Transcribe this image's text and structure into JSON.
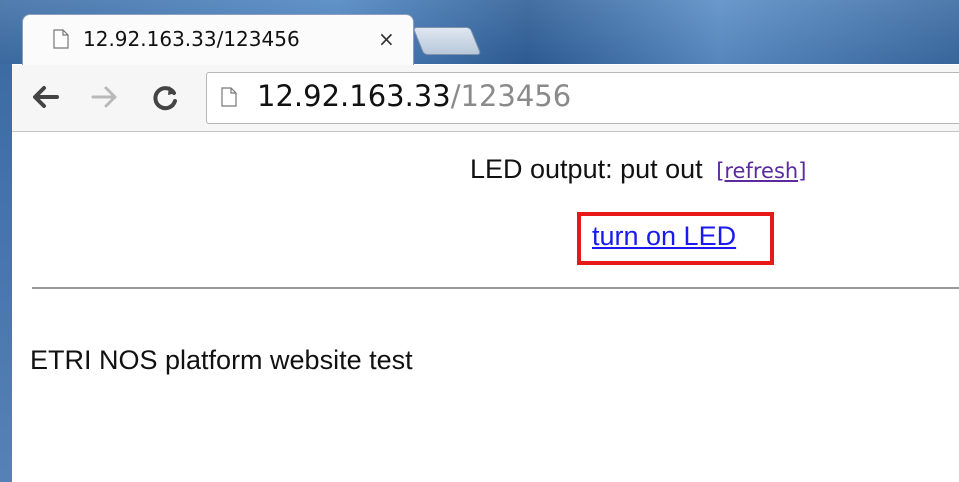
{
  "browser": {
    "tab": {
      "title": "12.92.163.33/123456",
      "close_glyph": "×"
    },
    "toolbar": {
      "back_icon": "back-arrow-icon",
      "forward_icon": "forward-arrow-icon",
      "reload_icon": "reload-icon"
    },
    "omnibox": {
      "host": "12.92.163.33",
      "path": "/123456"
    },
    "frame_color": "#4f86c2"
  },
  "page": {
    "led_status_label": "LED output: put out",
    "refresh_link": "[refresh]",
    "led_action_link": "turn on LED",
    "highlight_color": "#e81818",
    "footer_text": "ETRI NOS platform website test"
  }
}
